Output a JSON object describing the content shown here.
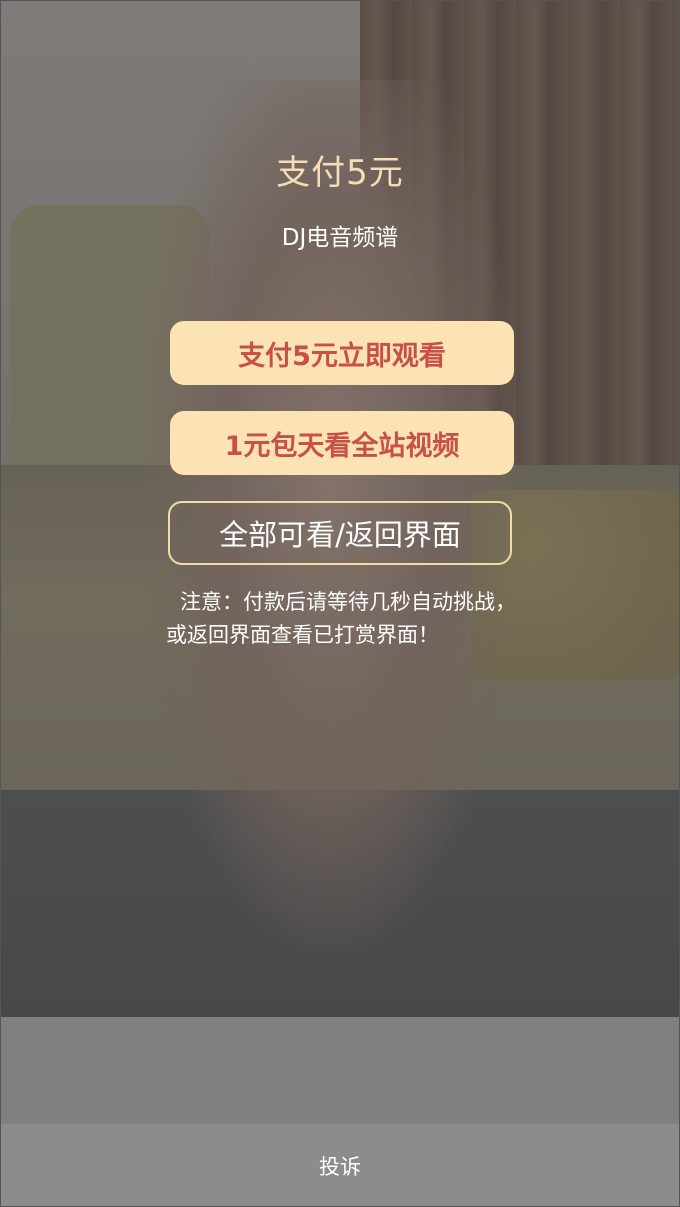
{
  "header": {
    "title": "支付5元",
    "subtitle": "DJ电音频谱"
  },
  "actions": {
    "pay_label": "支付5元立即观看",
    "day_pass_label": "1元包天看全站视频",
    "back_label": "全部可看/返回界面"
  },
  "notice": {
    "text": "注意：付款后请等待几秒自动挑战，或返回界面查看已打赏界面！"
  },
  "footer": {
    "complain_label": "投诉"
  },
  "colors": {
    "title": "#f5deb3",
    "button_bg": "#fbe3b3",
    "button_text": "#c8504a",
    "outline": "#f2dca1",
    "bottom_bar": "#8c8c8c"
  }
}
